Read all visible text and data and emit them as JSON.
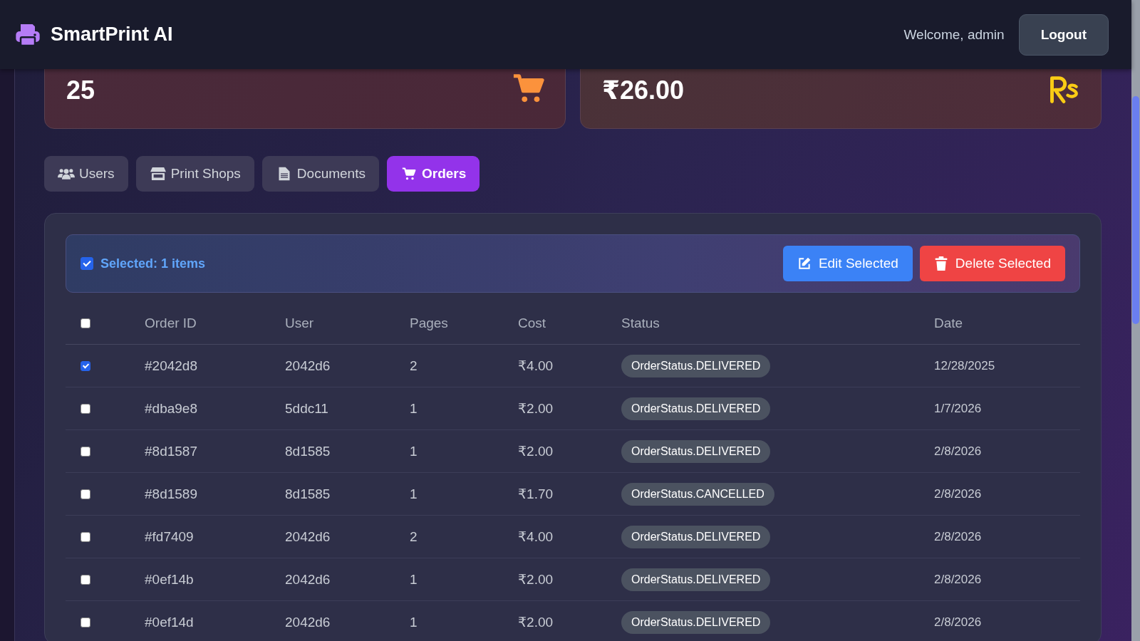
{
  "header": {
    "brand": "SmartPrint AI",
    "welcome": "Welcome, admin",
    "logout": "Logout"
  },
  "stats": [
    {
      "value": "25"
    },
    {
      "value": "₹26.00"
    }
  ],
  "tabs": [
    {
      "label": "Users",
      "selected": false
    },
    {
      "label": "Print Shops",
      "selected": false
    },
    {
      "label": "Documents",
      "selected": false
    },
    {
      "label": "Orders",
      "selected": true
    }
  ],
  "selection_bar": {
    "checked": true,
    "text": "Selected: 1 items",
    "edit": "Edit Selected",
    "delete": "Delete Selected"
  },
  "table": {
    "select_all": false,
    "columns": [
      "Order ID",
      "User",
      "Pages",
      "Cost",
      "Status",
      "Date"
    ],
    "rows": [
      {
        "checked": true,
        "id": "#2042d8",
        "user": "2042d6",
        "pages": "2",
        "cost": "₹4.00",
        "status": "OrderStatus.DELIVERED",
        "date": "12/28/2025"
      },
      {
        "checked": false,
        "id": "#dba9e8",
        "user": "5ddc11",
        "pages": "1",
        "cost": "₹2.00",
        "status": "OrderStatus.DELIVERED",
        "date": "1/7/2026"
      },
      {
        "checked": false,
        "id": "#8d1587",
        "user": "8d1585",
        "pages": "1",
        "cost": "₹2.00",
        "status": "OrderStatus.DELIVERED",
        "date": "2/8/2026"
      },
      {
        "checked": false,
        "id": "#8d1589",
        "user": "8d1585",
        "pages": "1",
        "cost": "₹1.70",
        "status": "OrderStatus.CANCELLED",
        "date": "2/8/2026"
      },
      {
        "checked": false,
        "id": "#fd7409",
        "user": "2042d6",
        "pages": "2",
        "cost": "₹4.00",
        "status": "OrderStatus.DELIVERED",
        "date": "2/8/2026"
      },
      {
        "checked": false,
        "id": "#0ef14b",
        "user": "2042d6",
        "pages": "1",
        "cost": "₹2.00",
        "status": "OrderStatus.DELIVERED",
        "date": "2/8/2026"
      },
      {
        "checked": false,
        "id": "#0ef14d",
        "user": "2042d6",
        "pages": "1",
        "cost": "₹2.00",
        "status": "OrderStatus.DELIVERED",
        "date": "2/8/2026"
      }
    ]
  }
}
